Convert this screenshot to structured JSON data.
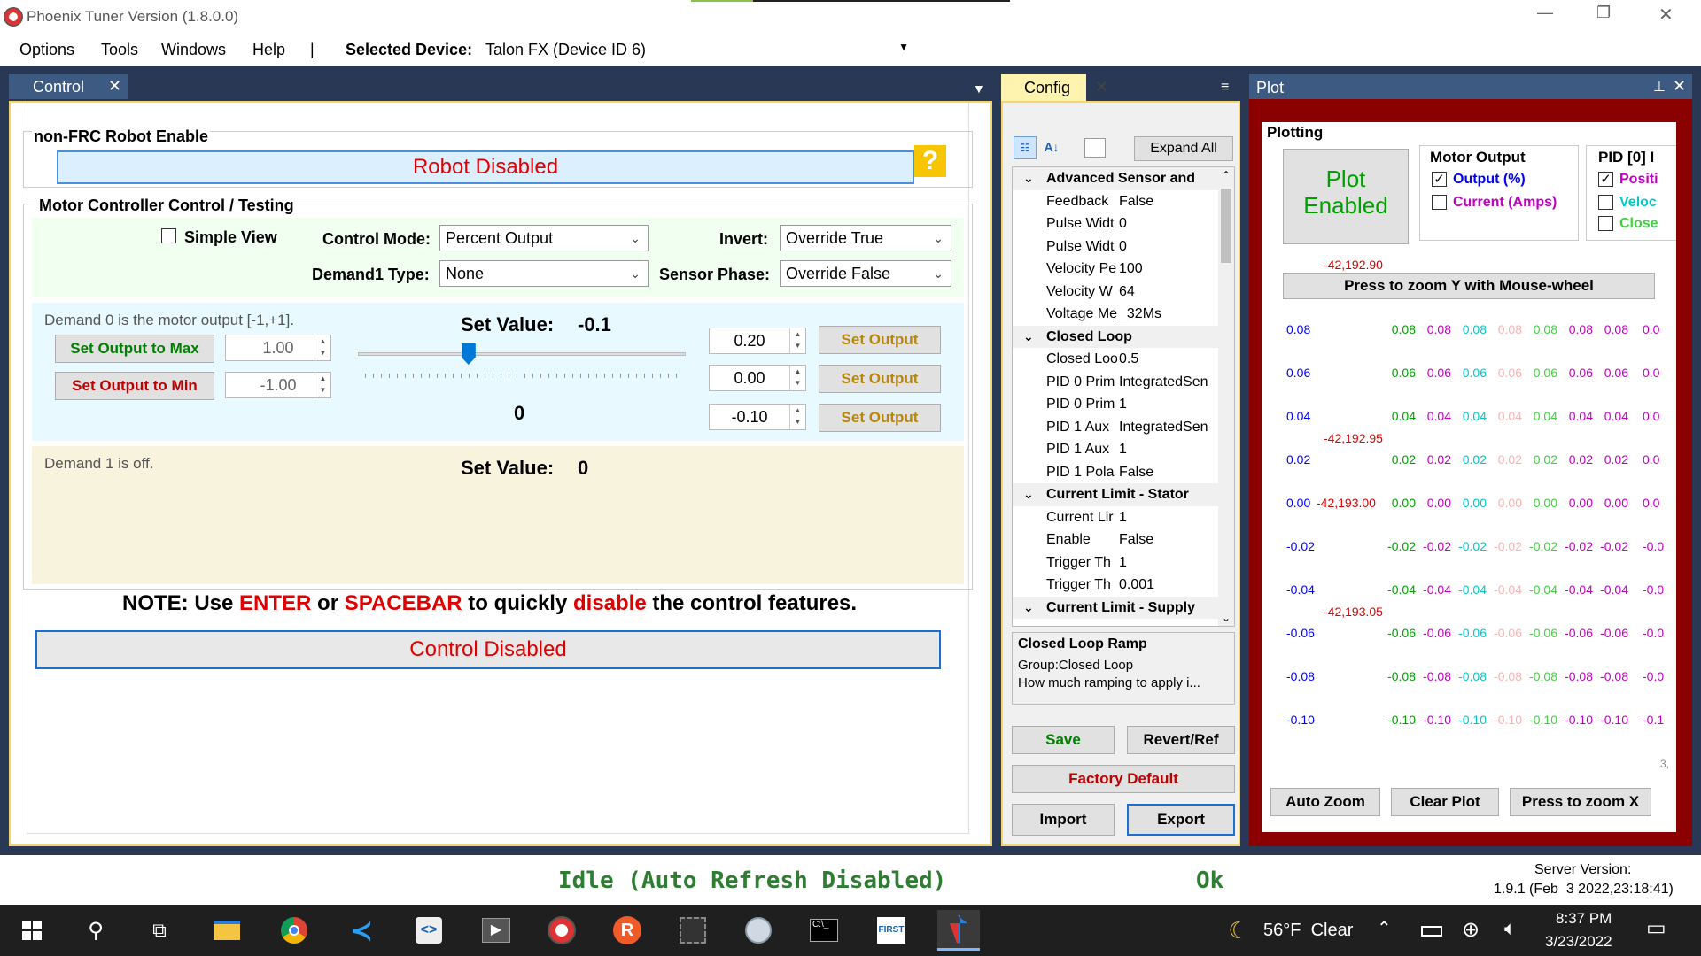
{
  "title_bar": {
    "title": "Phoenix Tuner Version (1.8.0.0)",
    "minimize": "—",
    "restore": "❐",
    "close": "✕"
  },
  "menu": {
    "items": [
      "Options",
      "Tools",
      "Windows",
      "Help"
    ],
    "separator": "|",
    "selected_device_label": "Selected Device:",
    "selected_device_value": "Talon FX (Device ID 6)"
  },
  "control_panel": {
    "tab_label": "Control",
    "nonfrc_label": "non-FRC Robot Enable",
    "robot_disabled": "Robot Disabled",
    "help_icon": "?",
    "mcc_label": "Motor Controller Control / Testing",
    "simple_view": "Simple View",
    "control_mode_label": "Control Mode:",
    "control_mode_value": "Percent Output",
    "invert_label": "Invert:",
    "invert_value": "Override True",
    "demand1_type_label": "Demand1 Type:",
    "demand1_type_value": "None",
    "sensor_phase_label": "Sensor Phase:",
    "sensor_phase_value": "Override False",
    "demand0_desc": "Demand 0 is the motor output [-1,+1].",
    "set_max_btn": "Set Output to Max",
    "max_value": "1.00",
    "set_min_btn": "Set Output to Min",
    "min_value": "-1.00",
    "set_value_label": "Set Value:",
    "set_value": "-0.1",
    "slider_center": "0",
    "slider_position": 0.33,
    "preset_values": [
      "0.20",
      "0.00",
      "-0.10"
    ],
    "set_output_btn": "Set Output",
    "demand1_desc": "Demand 1 is off.",
    "set_value1_label": "Set Value:",
    "set_value1": "0",
    "note_prefix": "NOTE: Use ",
    "note_enter": "ENTER",
    "note_or": " or ",
    "note_spacebar": "SPACEBAR",
    "note_to": " to quickly ",
    "note_disable": "disable",
    "note_suffix": " the control features.",
    "control_disabled": "Control Disabled"
  },
  "config_panel": {
    "tab_label": "Config",
    "expand_all": "Expand All",
    "rows": [
      {
        "type": "cat",
        "text": "Advanced Sensor and"
      },
      {
        "type": "prop",
        "name": "Feedback",
        "value": "False"
      },
      {
        "type": "prop",
        "name": "Pulse Widt",
        "value": "0"
      },
      {
        "type": "prop",
        "name": "Pulse Widt",
        "value": "0"
      },
      {
        "type": "prop",
        "name": "Velocity Pe",
        "value": "100"
      },
      {
        "type": "prop",
        "name": "Velocity W",
        "value": "64"
      },
      {
        "type": "prop",
        "name": "Voltage Me",
        "value": "_32Ms"
      },
      {
        "type": "cat",
        "text": "Closed Loop"
      },
      {
        "type": "prop",
        "name": "Closed Loo",
        "value": "0.5"
      },
      {
        "type": "prop",
        "name": "PID 0 Prim",
        "value": "IntegratedSen"
      },
      {
        "type": "prop",
        "name": "PID 0 Prim",
        "value": "1"
      },
      {
        "type": "prop",
        "name": "PID 1 Aux",
        "value": "IntegratedSen"
      },
      {
        "type": "prop",
        "name": "PID 1 Aux",
        "value": "1"
      },
      {
        "type": "prop",
        "name": "PID 1 Pola",
        "value": "False"
      },
      {
        "type": "cat",
        "text": "Current Limit - Stator"
      },
      {
        "type": "prop",
        "name": "Current Lir",
        "value": "1"
      },
      {
        "type": "prop",
        "name": "Enable",
        "value": "False"
      },
      {
        "type": "prop",
        "name": "Trigger Th",
        "value": "1"
      },
      {
        "type": "prop",
        "name": "Trigger Th",
        "value": "0.001"
      },
      {
        "type": "cat",
        "text": "Current Limit - Supply"
      }
    ],
    "desc_title": "Closed Loop Ramp",
    "desc_group": "Group:Closed Loop",
    "desc_text": "How much ramping to apply i...",
    "save": "Save",
    "revert": "Revert/Ref",
    "factory_default": "Factory Default",
    "import": "Import",
    "export": "Export"
  },
  "plot_panel": {
    "title": "Plot",
    "plotting_label": "Plotting",
    "plot_enabled_line1": "Plot",
    "plot_enabled_line2": "Enabled",
    "motor_output_label": "Motor Output",
    "output_pct": "Output (%)",
    "current_amps": "Current (Amps)",
    "pid_label": "PID [0] I",
    "pid_items": [
      "Positi",
      "Veloc",
      "Close"
    ],
    "zoom_y": "Press to zoom Y with Mouse-wheel",
    "auto_zoom": "Auto Zoom",
    "clear_plot": "Clear Plot",
    "zoom_x": "Press to zoom X",
    "corner_label": "3,",
    "right_axis": [
      "-42,192.90",
      "-42,192.95",
      "-42,193.00",
      "-42,193.05"
    ],
    "rows": [
      "0.08",
      "0.06",
      "0.04",
      "0.02",
      "0.00",
      "-0.02",
      "-0.04",
      "-0.06",
      "-0.08",
      "-0.10"
    ],
    "trunc_rows": [
      "0.0",
      "0.0",
      "0.0",
      "0.0",
      "0.0",
      "-0.0",
      "-0.0",
      "-0.0",
      "-0.0",
      "-0.1"
    ],
    "colors": {
      "blue": "#0000ff",
      "green": "#00a000",
      "magenta": "#c000c0",
      "cyan": "#00c8c8",
      "pink": "#ffb0b0",
      "lime": "#40d040",
      "red": "#e00000"
    }
  },
  "status_bar": {
    "idle": "Idle (Auto Refresh Disabled)",
    "ok": "Ok",
    "server_label": "Server Version:",
    "server_value": "1.9.1 (Feb  3 2022,23:18:41)"
  },
  "taskbar": {
    "weather": "56°F  Clear",
    "time": "8:37 PM",
    "date": "3/23/2022"
  }
}
